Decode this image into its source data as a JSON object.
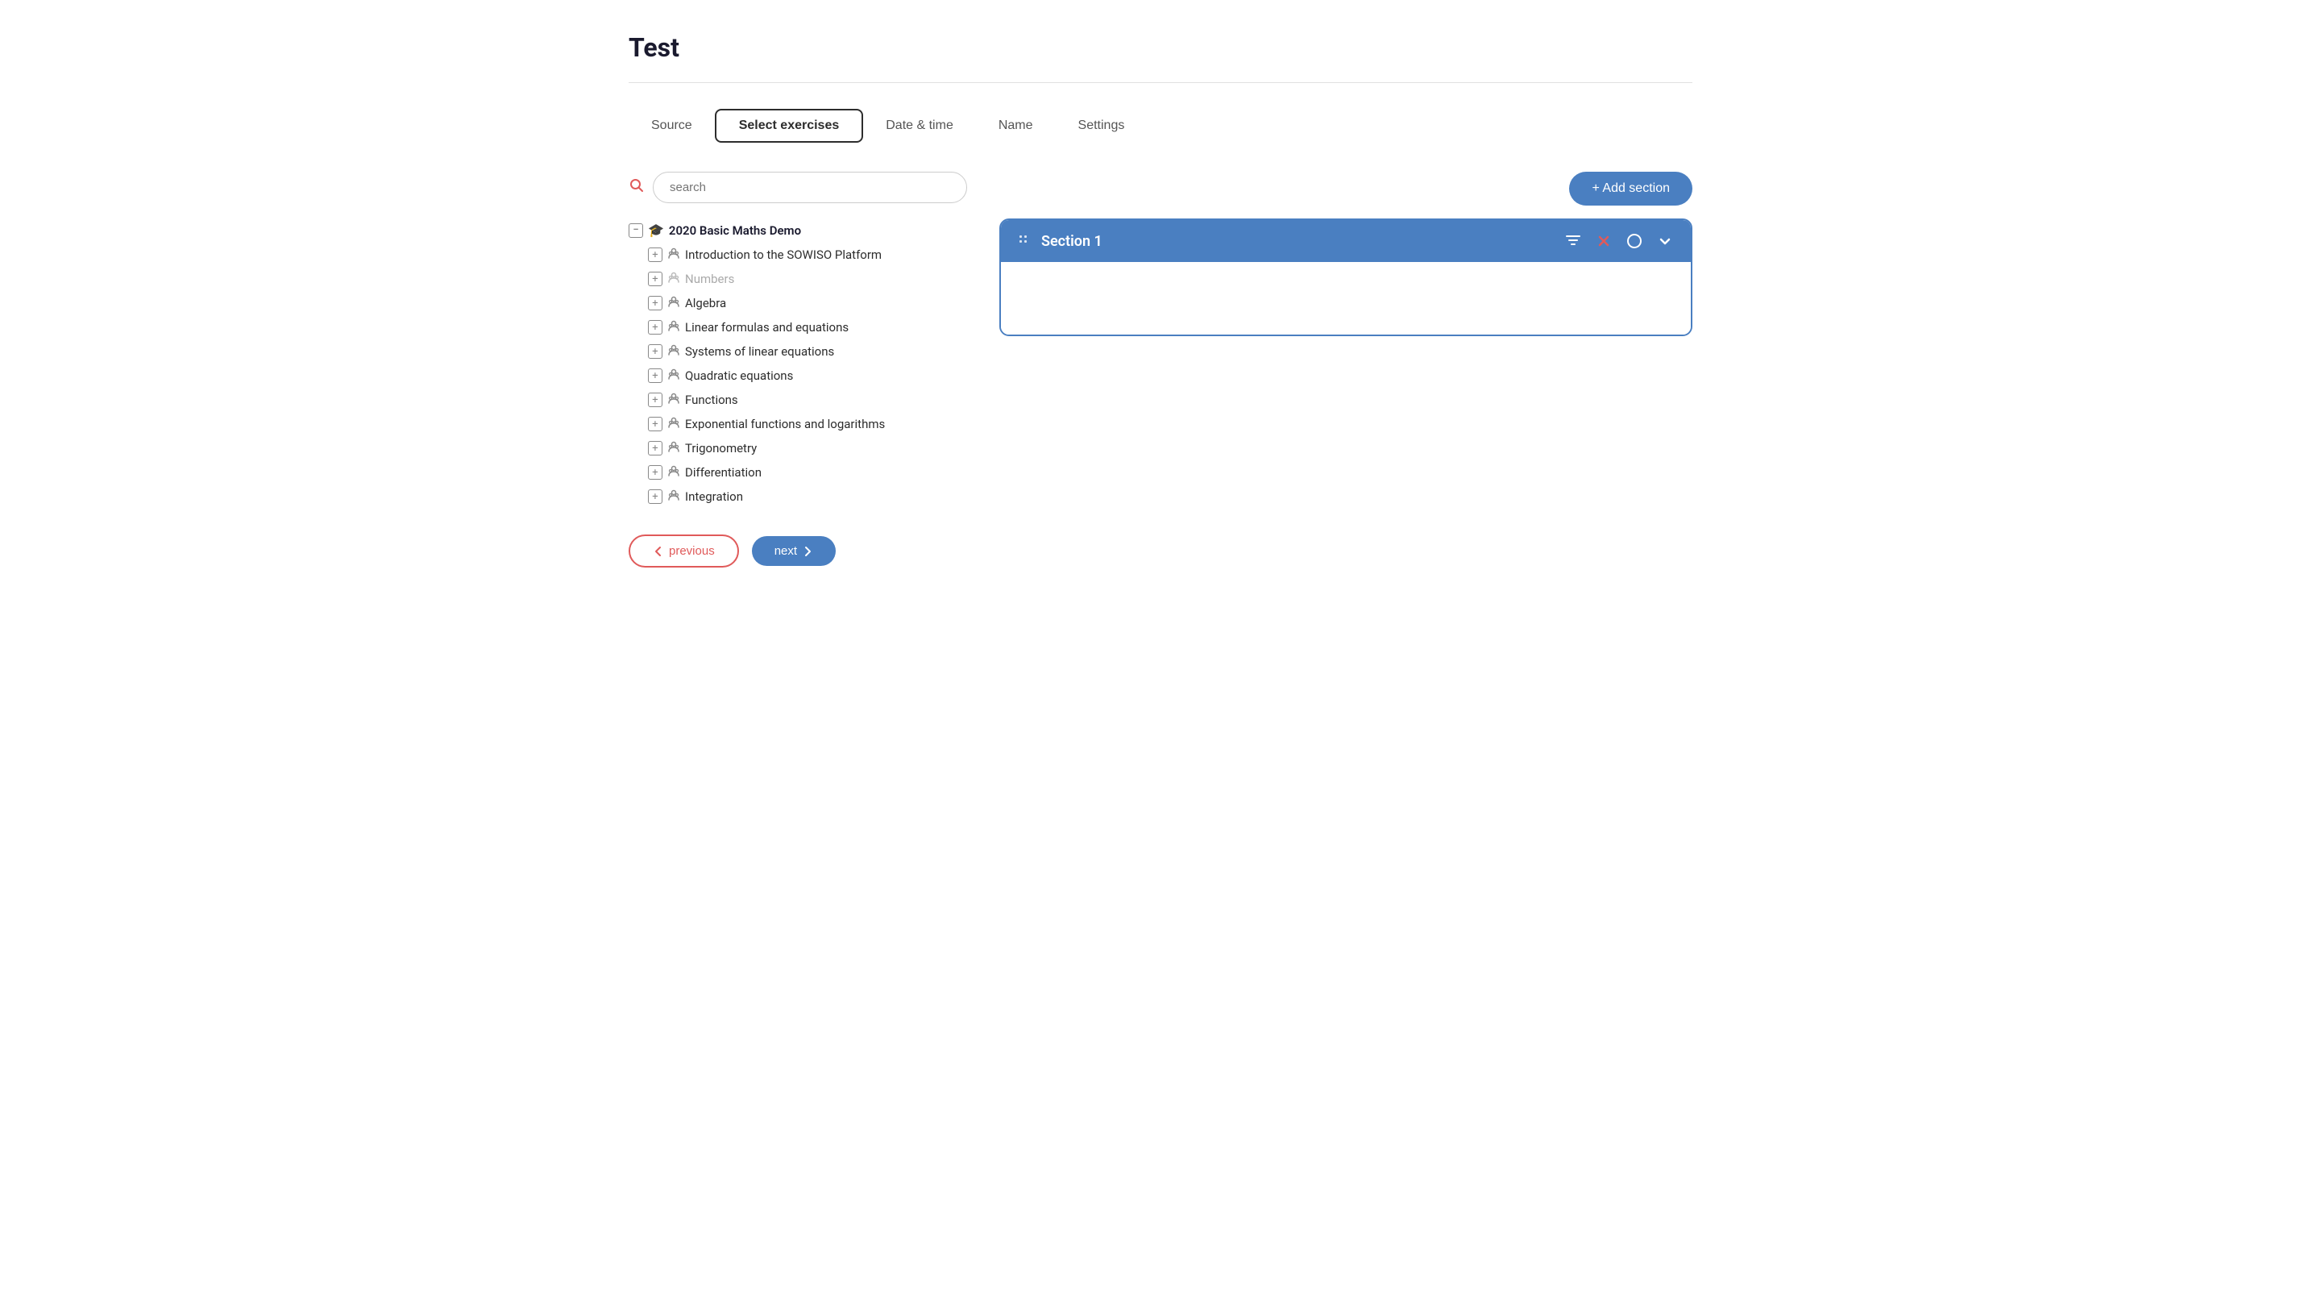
{
  "page": {
    "title": "Test"
  },
  "tabs": [
    {
      "id": "source",
      "label": "Source",
      "active": false
    },
    {
      "id": "select-exercises",
      "label": "Select exercises",
      "active": true
    },
    {
      "id": "date-time",
      "label": "Date & time",
      "active": false
    },
    {
      "id": "name",
      "label": "Name",
      "active": false
    },
    {
      "id": "settings",
      "label": "Settings",
      "active": false
    }
  ],
  "search": {
    "placeholder": "search"
  },
  "tree": {
    "root": {
      "label": "2020 Basic Maths Demo"
    },
    "items": [
      {
        "id": "intro",
        "label": "Introduction to the SOWISO Platform",
        "disabled": false
      },
      {
        "id": "numbers",
        "label": "Numbers",
        "disabled": true
      },
      {
        "id": "algebra",
        "label": "Algebra",
        "disabled": false
      },
      {
        "id": "linear",
        "label": "Linear formulas and equations",
        "disabled": false
      },
      {
        "id": "systems",
        "label": "Systems of linear equations",
        "disabled": false
      },
      {
        "id": "quadratic",
        "label": "Quadratic equations",
        "disabled": false
      },
      {
        "id": "functions",
        "label": "Functions",
        "disabled": false
      },
      {
        "id": "exponential",
        "label": "Exponential functions and logarithms",
        "disabled": false
      },
      {
        "id": "trig",
        "label": "Trigonometry",
        "disabled": false
      },
      {
        "id": "diff",
        "label": "Differentiation",
        "disabled": false
      },
      {
        "id": "integration",
        "label": "Integration",
        "disabled": false
      }
    ]
  },
  "right_panel": {
    "add_section_label": "+ Add section",
    "section": {
      "title": "Section 1"
    }
  },
  "footer": {
    "previous_label": "previous",
    "next_label": "next"
  }
}
